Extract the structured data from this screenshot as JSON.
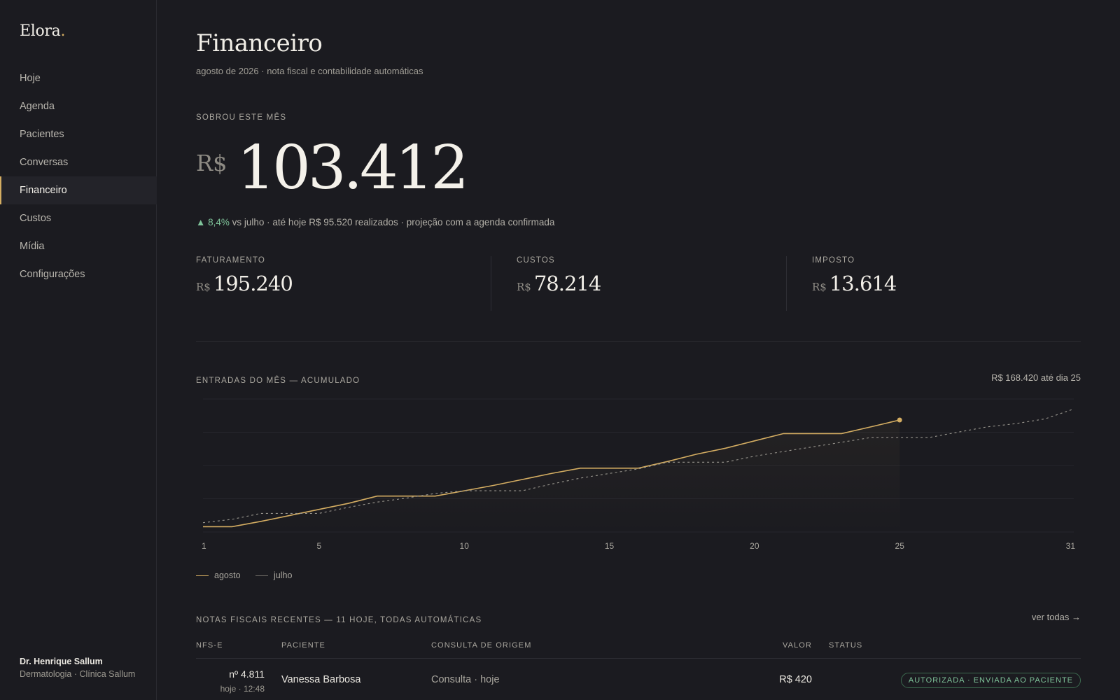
{
  "app": {
    "logo": "Elora",
    "logo_dot": "."
  },
  "sidebar": {
    "items": [
      {
        "label": "Hoje",
        "active": false
      },
      {
        "label": "Agenda",
        "active": false
      },
      {
        "label": "Pacientes",
        "active": false
      },
      {
        "label": "Conversas",
        "active": false
      },
      {
        "label": "Financeiro",
        "active": true
      },
      {
        "label": "Custos",
        "active": false
      },
      {
        "label": "Mídia",
        "active": false
      },
      {
        "label": "Configurações",
        "active": false
      }
    ],
    "profile": {
      "name": "Dr. Henrique Sallum",
      "subtitle": "Dermatologia · Clínica Sallum"
    }
  },
  "header": {
    "title": "Financeiro",
    "subtitle": "agosto de 2026 · nota fiscal e contabilidade automáticas"
  },
  "hero": {
    "label": "SOBROU ESTE MÊS",
    "currency": "R$",
    "value": "103.412",
    "change": "▲ 8,4%",
    "note": " vs julho · até hoje R$ 95.520 realizados · projeção com a agenda confirmada"
  },
  "kpis": [
    {
      "label": "FATURAMENTO",
      "currency": "R$",
      "value": "195.240"
    },
    {
      "label": "CUSTOS",
      "currency": "R$",
      "value": "78.214"
    },
    {
      "label": "IMPOSTO",
      "currency": "R$",
      "value": "13.614"
    }
  ],
  "chart_section": {
    "title": "ENTRADAS DO MÊS — ACUMULADO",
    "total": "R$ 168.420 até dia 25"
  },
  "chart_data": {
    "type": "line",
    "x_ticks": [
      "1",
      "5",
      "10",
      "15",
      "20",
      "25",
      "31"
    ],
    "xlim": [
      1,
      31
    ],
    "ylim": [
      0,
      200000
    ],
    "grid": true,
    "legend_placement": "bottom-left",
    "series": [
      {
        "name": "agosto",
        "color": "#d4ad62",
        "style": "solid",
        "x": [
          1,
          2,
          3,
          4,
          5,
          6,
          7,
          8,
          9,
          10,
          11,
          12,
          13,
          14,
          15,
          16,
          17,
          18,
          19,
          20,
          21,
          22,
          23,
          24,
          25
        ],
        "y": [
          8000,
          8000,
          16000,
          25000,
          34000,
          43000,
          54000,
          54000,
          54000,
          62000,
          70000,
          79000,
          88000,
          96000,
          96000,
          96000,
          106000,
          117000,
          126000,
          137000,
          148000,
          148000,
          148000,
          158000,
          168420
        ]
      },
      {
        "name": "julho",
        "color": "#9a978f",
        "style": "dashed",
        "x": [
          1,
          2,
          3,
          4,
          5,
          6,
          7,
          8,
          9,
          10,
          11,
          12,
          13,
          14,
          15,
          16,
          17,
          18,
          19,
          20,
          21,
          22,
          23,
          24,
          25,
          26,
          27,
          28,
          29,
          30,
          31
        ],
        "y": [
          14000,
          19000,
          28000,
          28000,
          28000,
          37000,
          45000,
          51000,
          58000,
          62000,
          62000,
          62000,
          72000,
          81000,
          88000,
          95000,
          105000,
          105000,
          105000,
          114000,
          121000,
          128000,
          135000,
          142000,
          142000,
          142000,
          150000,
          158000,
          163000,
          170000,
          185000
        ]
      }
    ]
  },
  "legend": {
    "agosto": "agosto",
    "julho": "julho"
  },
  "invoices": {
    "title": "NOTAS FISCAIS RECENTES — 11 HOJE, TODAS AUTOMÁTICAS",
    "link": "ver todas →",
    "columns": {
      "nf": "NFS-E",
      "patient": "PACIENTE",
      "origin": "CONSULTA DE ORIGEM",
      "value": "VALOR",
      "status": "STATUS"
    },
    "rows": [
      {
        "number": "nº 4.811",
        "time": "hoje · 12:48",
        "patient": "Vanessa Barbosa",
        "origin": "Consulta · hoje",
        "value": "R$ 420",
        "status": "AUTORIZADA · ENVIADA AO PACIENTE"
      }
    ]
  }
}
